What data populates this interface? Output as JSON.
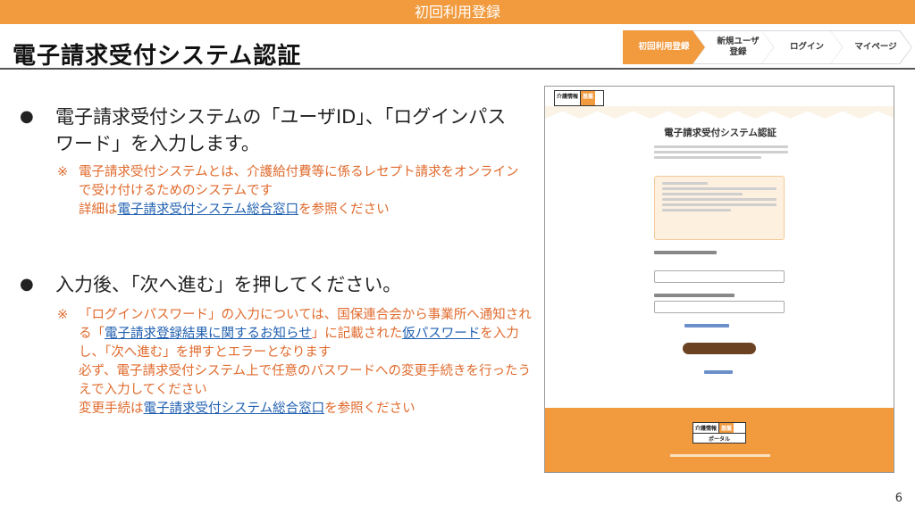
{
  "header": {
    "bar_title": "初回利用登録",
    "page_title": "電子請求受付システム認証"
  },
  "steps": [
    {
      "label": "初回利用登録",
      "active": true
    },
    {
      "label": "新規ユーザ\n登録",
      "active": false
    },
    {
      "label": "ログイン",
      "active": false
    },
    {
      "label": "マイページ",
      "active": false
    }
  ],
  "bullets": [
    {
      "text": "電子請求受付システムの「ユーザID」、「ログインパスワード」を入力します。",
      "note_mark": "※",
      "note_lines": [
        "電子請求受付システムとは、介護給付費等に係るレセプト請求をオンラインで受け付けるためのシステムです"
      ],
      "note_prefix": "詳細は",
      "note_link": "電子請求受付システム総合窓口",
      "note_suffix": "を参照ください"
    },
    {
      "text": "入力後、「次へ進む」を押してください。",
      "note_mark": "※",
      "note_a": "「ログインパスワード」の入力については、国保連合会から事業所へ通知される「",
      "note_link_a": "電子請求登録結果に関するお知らせ",
      "note_b": "」に記載された",
      "note_link_b": "仮パスワード",
      "note_c": "を入力し、「次へ進む」を押すとエラーとなります",
      "note_d": "必ず、電子請求受付システム上で任意のパスワードへの変更手続きを行ったうえで入力してください",
      "note_prefix": "変更手続は",
      "note_link": "電子請求受付システム総合窓口",
      "note_suffix": "を参照ください"
    }
  ],
  "screenshot": {
    "logo_a": "介護情報",
    "logo_b": "基盤",
    "logo_c": "ポータル",
    "title": "電子請求受付システム認証"
  },
  "page_number": "6"
}
